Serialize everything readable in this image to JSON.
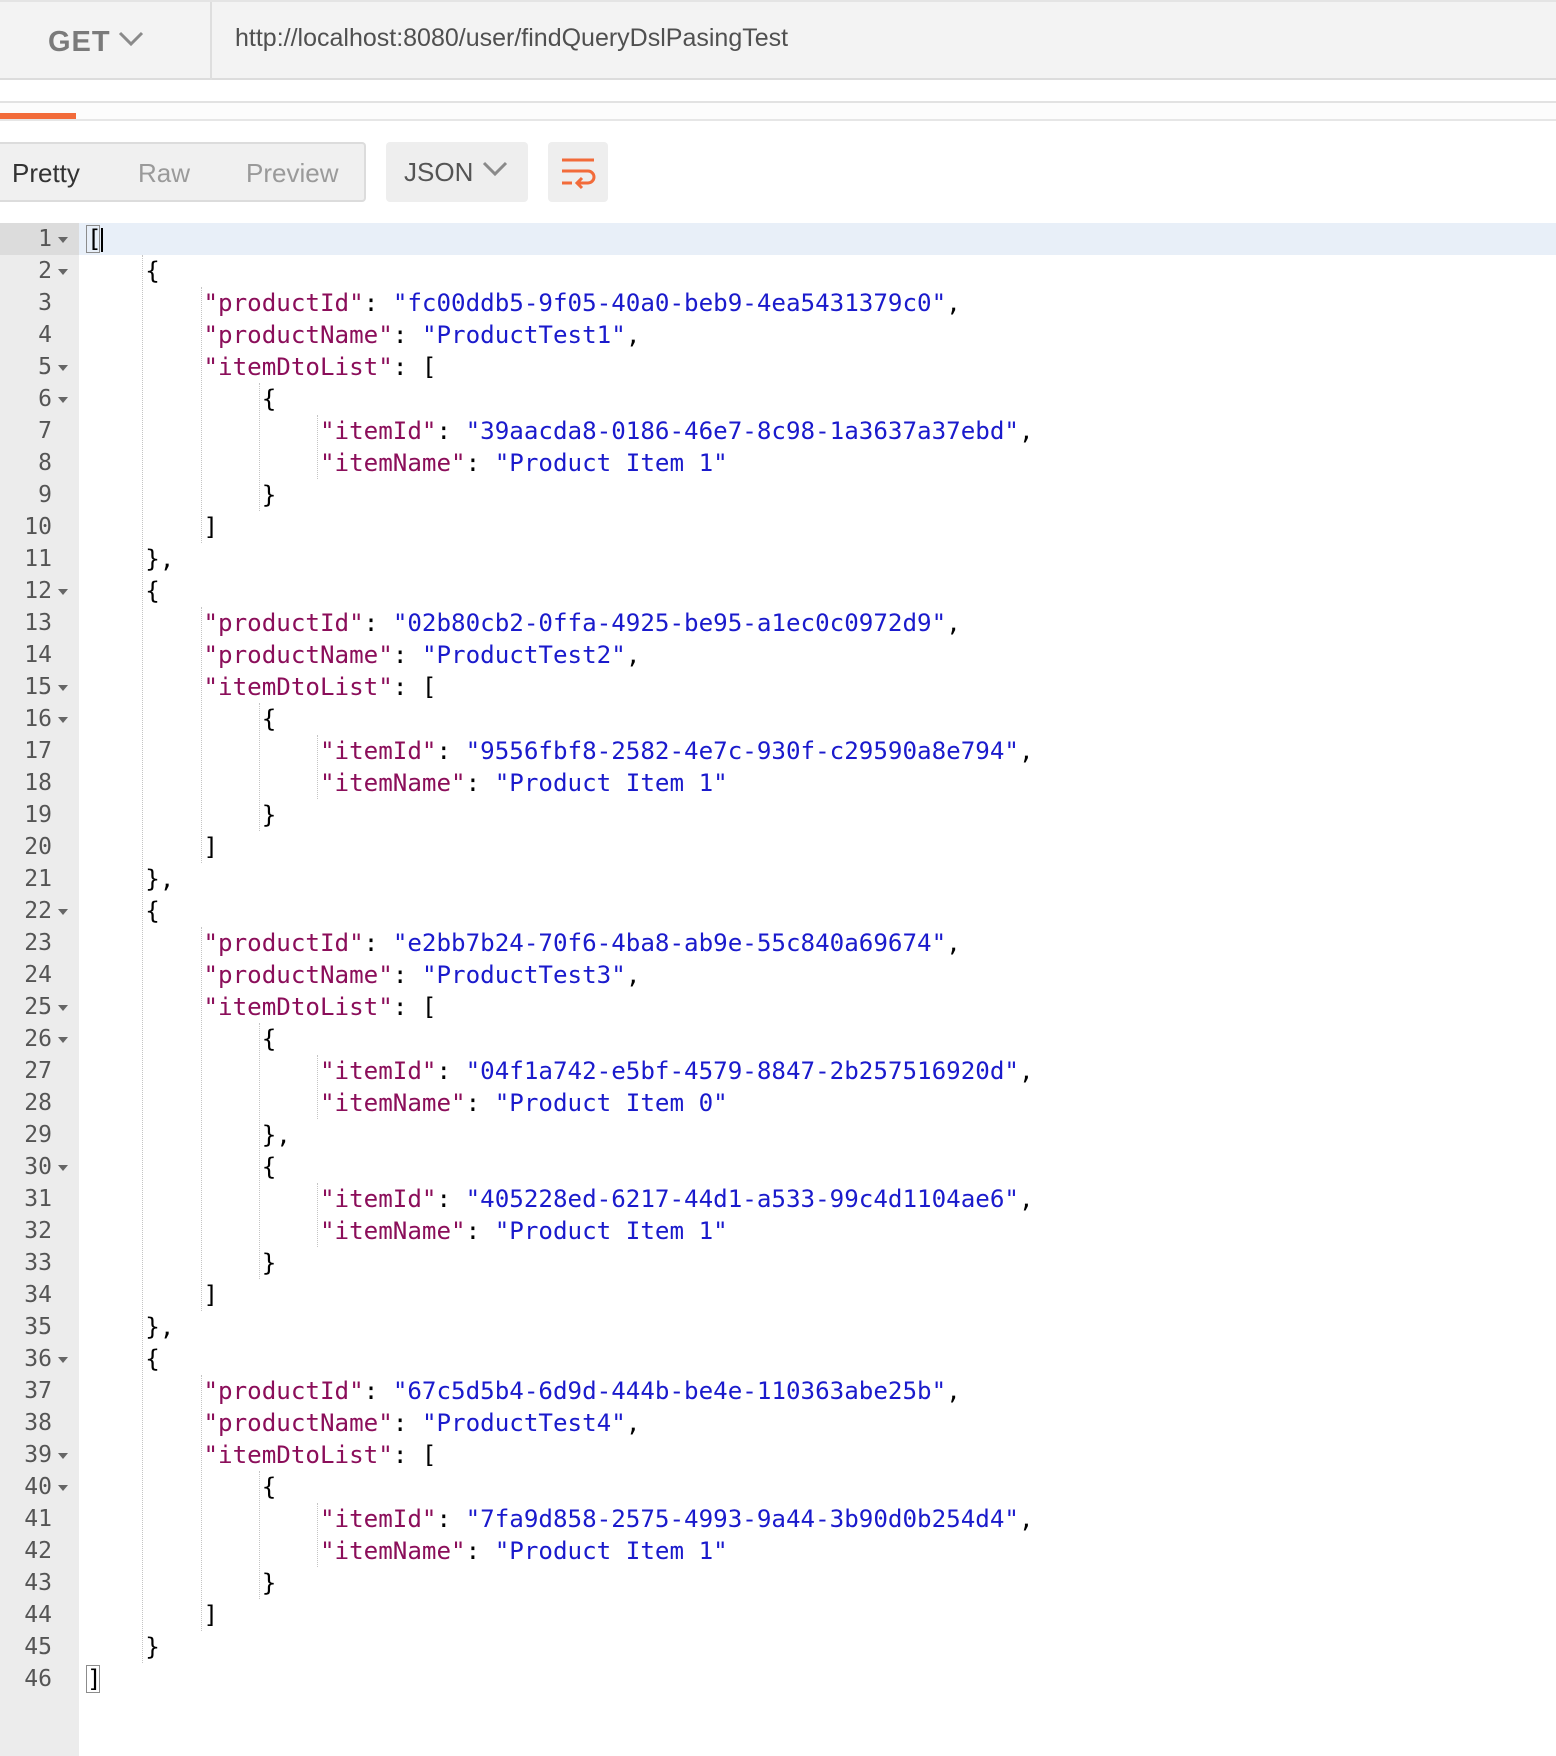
{
  "request": {
    "method": "GET",
    "url": "http://localhost:8080/user/findQueryDslPasingTest"
  },
  "response_view": {
    "tabs": [
      "Pretty",
      "Raw",
      "Preview"
    ],
    "active_tab": "Pretty",
    "format": "JSON",
    "icons": {
      "method_dropdown": "chevron-down-icon",
      "format_dropdown": "chevron-down-icon",
      "wrap": "wrap-lines-icon"
    },
    "colors": {
      "accent": "#f26b3a",
      "json_key": "#8b0e5a",
      "json_string": "#1a1acc"
    }
  },
  "response_body": [
    {
      "productId": "fc00ddb5-9f05-40a0-beb9-4ea5431379c0",
      "productName": "ProductTest1",
      "itemDtoList": [
        {
          "itemId": "39aacda8-0186-46e7-8c98-1a3637a37ebd",
          "itemName": "Product Item 1"
        }
      ]
    },
    {
      "productId": "02b80cb2-0ffa-4925-be95-a1ec0c0972d9",
      "productName": "ProductTest2",
      "itemDtoList": [
        {
          "itemId": "9556fbf8-2582-4e7c-930f-c29590a8e794",
          "itemName": "Product Item 1"
        }
      ]
    },
    {
      "productId": "e2bb7b24-70f6-4ba8-ab9e-55c840a69674",
      "productName": "ProductTest3",
      "itemDtoList": [
        {
          "itemId": "04f1a742-e5bf-4579-8847-2b257516920d",
          "itemName": "Product Item 0"
        },
        {
          "itemId": "405228ed-6217-44d1-a533-99c4d1104ae6",
          "itemName": "Product Item 1"
        }
      ]
    },
    {
      "productId": "67c5d5b4-6d9d-444b-be4e-110363abe25b",
      "productName": "ProductTest4",
      "itemDtoList": [
        {
          "itemId": "7fa9d858-2575-4993-9a44-3b90d0b254d4",
          "itemName": "Product Item 1"
        }
      ]
    }
  ]
}
